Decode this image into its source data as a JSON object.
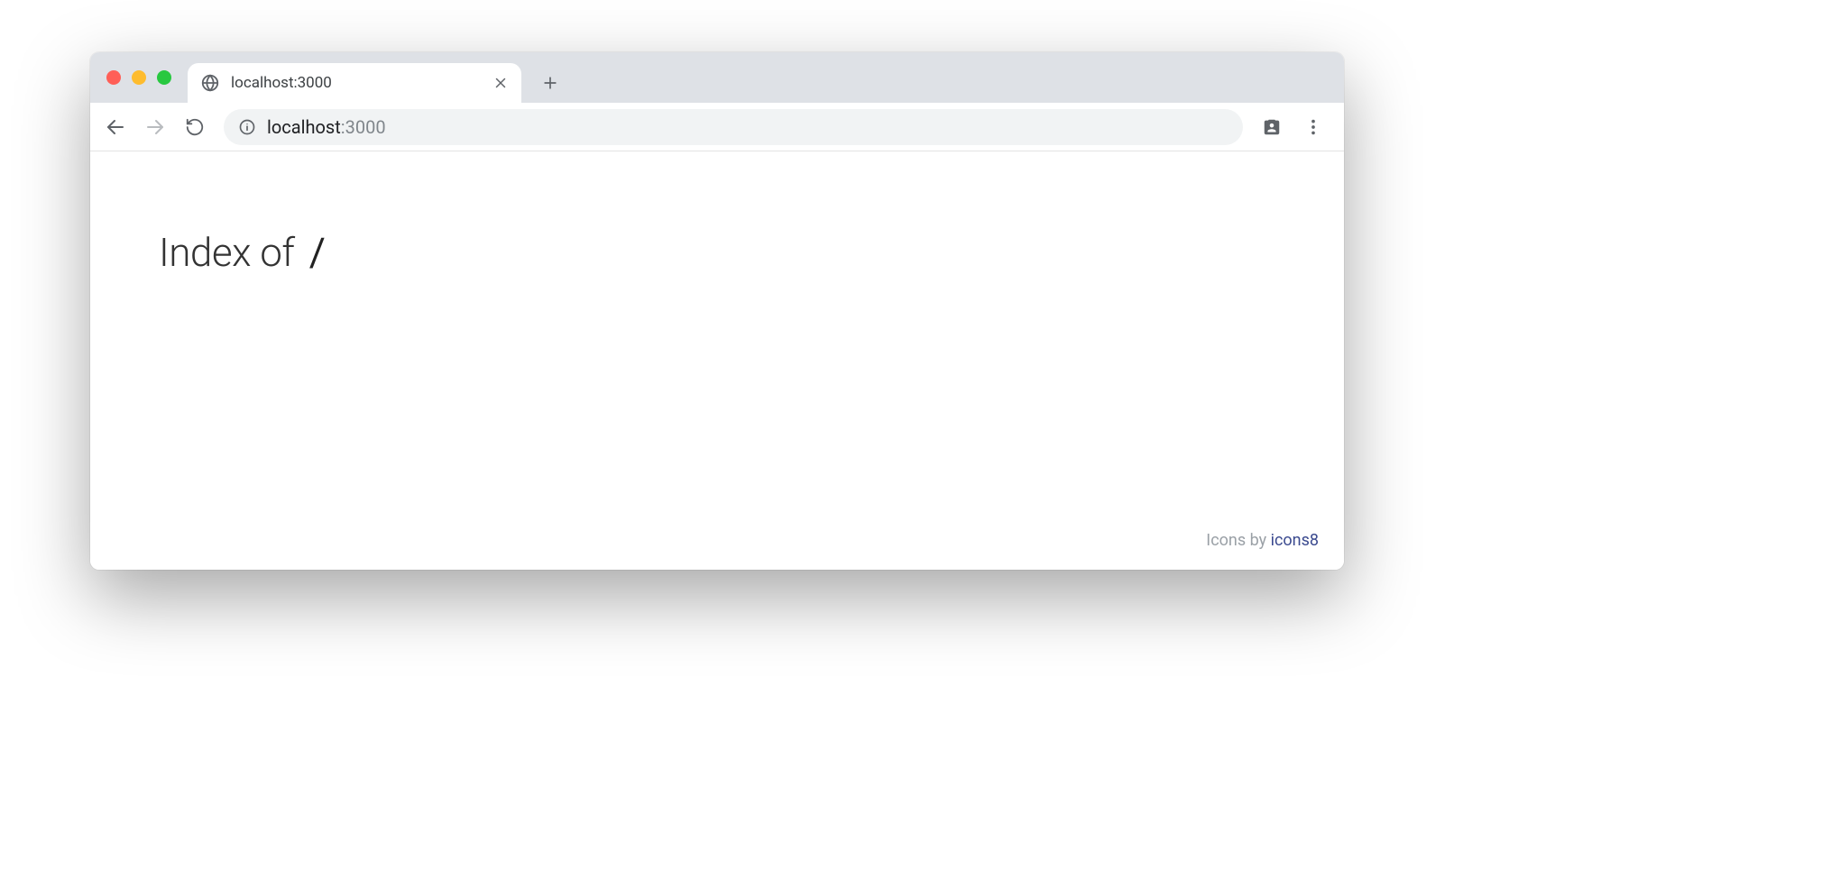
{
  "browser": {
    "tab_title": "localhost:3000",
    "address_host": "localhost",
    "address_port": ":3000"
  },
  "page": {
    "heading_prefix": "Index of",
    "heading_path": "/",
    "footer_prefix": "Icons by ",
    "footer_link": "icons8"
  }
}
